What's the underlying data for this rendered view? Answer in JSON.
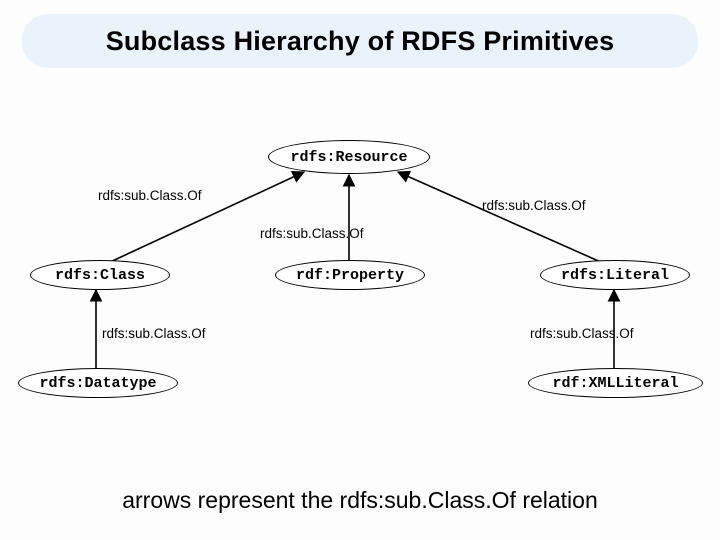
{
  "title": "Subclass Hierarchy of RDFS Primitives",
  "nodes": {
    "resource": "rdfs:Resource",
    "class": "rdfs:Class",
    "property": "rdf:Property",
    "literal": "rdfs:Literal",
    "datatype": "rdfs:Datatype",
    "xmlliteral": "rdf:XMLLiteral"
  },
  "edge_label": "rdfs:sub.Class.Of",
  "caption": "arrows represent the rdfs:sub.Class.Of relation",
  "chart_data": {
    "type": "graph",
    "title": "Subclass Hierarchy of RDFS Primitives",
    "nodes": [
      "rdfs:Resource",
      "rdfs:Class",
      "rdf:Property",
      "rdfs:Literal",
      "rdfs:Datatype",
      "rdf:XMLLiteral"
    ],
    "edges": [
      {
        "from": "rdfs:Class",
        "to": "rdfs:Resource",
        "label": "rdfs:subClassOf"
      },
      {
        "from": "rdf:Property",
        "to": "rdfs:Resource",
        "label": "rdfs:subClassOf"
      },
      {
        "from": "rdfs:Literal",
        "to": "rdfs:Resource",
        "label": "rdfs:subClassOf"
      },
      {
        "from": "rdfs:Datatype",
        "to": "rdfs:Class",
        "label": "rdfs:subClassOf"
      },
      {
        "from": "rdf:XMLLiteral",
        "to": "rdfs:Literal",
        "label": "rdfs:subClassOf"
      }
    ],
    "relation": "rdfs:subClassOf"
  }
}
